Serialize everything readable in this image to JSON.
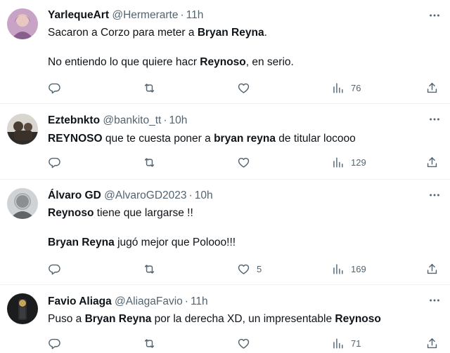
{
  "tweets": [
    {
      "name": "YarlequeArt",
      "handle": "@Hermerarte",
      "time": "11h",
      "lines": [
        [
          {
            "t": "Sacaron a Corzo para meter a "
          },
          {
            "t": "Bryan Reyna",
            "b": true
          },
          {
            "t": "."
          }
        ],
        [],
        [
          {
            "t": "No entiendo lo que quiere hacr "
          },
          {
            "t": "Reynoso",
            "b": true
          },
          {
            "t": ", en serio."
          }
        ]
      ],
      "likes": "",
      "views": "76"
    },
    {
      "name": "Eztebnkto",
      "handle": "@bankito_tt",
      "time": "10h",
      "lines": [
        [
          {
            "t": "REYNOSO",
            "b": true
          },
          {
            "t": " que te cuesta poner a "
          },
          {
            "t": "bryan reyna",
            "b": true
          },
          {
            "t": " de titular locooo"
          }
        ]
      ],
      "likes": "",
      "views": "129"
    },
    {
      "name": "Álvaro GD",
      "handle": "@AlvaroGD2023",
      "time": "10h",
      "lines": [
        [
          {
            "t": "Reynoso",
            "b": true
          },
          {
            "t": " tiene que largarse !!"
          }
        ],
        [],
        [
          {
            "t": "Bryan Reyna",
            "b": true
          },
          {
            "t": " jugó mejor que Polooo!!!"
          }
        ]
      ],
      "likes": "5",
      "views": "169"
    },
    {
      "name": "Favio Aliaga",
      "handle": "@AliagaFavio",
      "time": "11h",
      "lines": [
        [
          {
            "t": "Puso a "
          },
          {
            "t": "Bryan Reyna",
            "b": true
          },
          {
            "t": " por la derecha XD, un impresentable "
          },
          {
            "t": "Reynoso",
            "b": true
          }
        ]
      ],
      "likes": "",
      "views": "71"
    }
  ],
  "separator": "·",
  "icons": {
    "more": "more-options-icon",
    "reply": "reply-icon",
    "retweet": "retweet-icon",
    "like": "like-heart-icon",
    "views": "views-chart-icon",
    "share": "share-icon"
  },
  "colors": {
    "text": "#0f1419",
    "secondary": "#536471",
    "divider": "#eff3f4"
  }
}
